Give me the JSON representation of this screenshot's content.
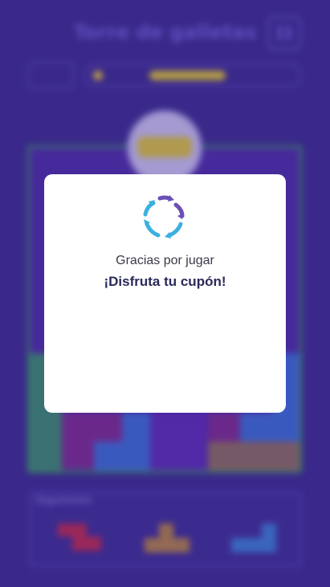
{
  "game": {
    "title": "Torre de galletas",
    "level_label": "",
    "score_text": "",
    "score_progress": 0.34,
    "cookie_label": "",
    "next_label": "Siguiente"
  },
  "modal": {
    "line1": "Gracias por jugar",
    "line2": "¡Disfruta tu cupón!",
    "logo": "circular-arrows-logo-icon"
  },
  "colors": {
    "background": "#3a2a8a",
    "board_border": "#3a9a5a",
    "logo_purple": "#6a4fb6",
    "logo_blue": "#3bb0e0"
  }
}
